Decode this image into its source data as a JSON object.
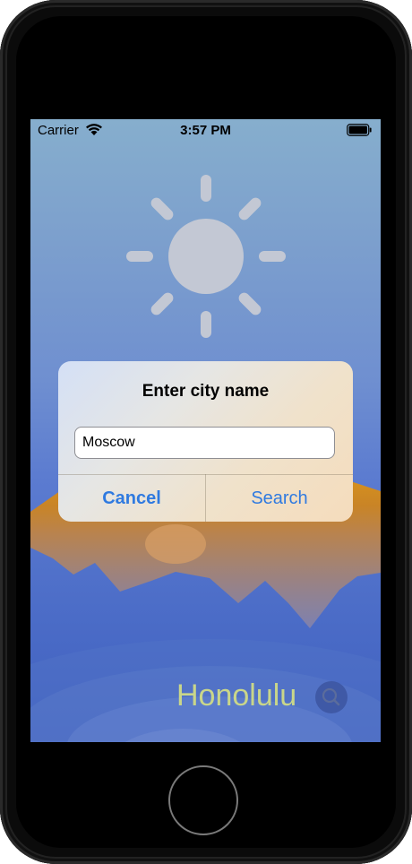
{
  "status_bar": {
    "carrier": "Carrier",
    "time": "3:57 PM",
    "wifi_icon": "wifi-icon",
    "battery_icon": "battery-icon"
  },
  "weather": {
    "icon": "sun-icon",
    "city": "Honolulu",
    "search_icon": "search-icon"
  },
  "alert": {
    "title": "Enter city name",
    "input_value": "Moscow",
    "cancel_label": "Cancel",
    "search_label": "Search"
  },
  "colors": {
    "accent": "#2f7ae0",
    "city_text": "#c9d68a"
  }
}
